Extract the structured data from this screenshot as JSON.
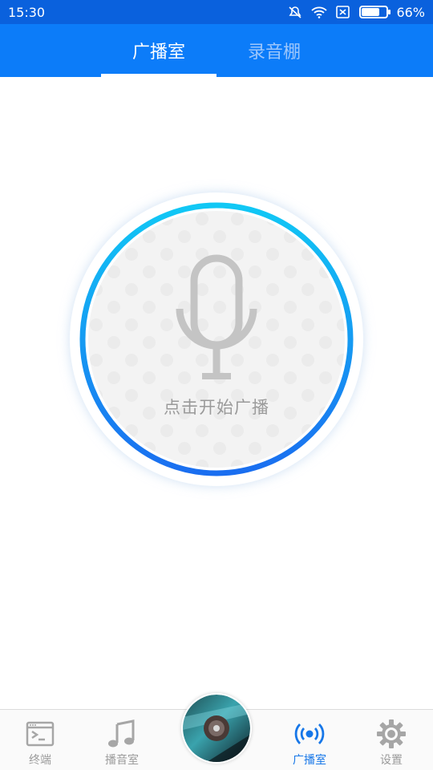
{
  "status_bar": {
    "time": "15:30",
    "battery": "66%",
    "battery_level": 0.66,
    "icons": [
      "mute-icon",
      "wifi-icon",
      "sim-icon",
      "battery-icon"
    ]
  },
  "tabs": [
    {
      "label": "广播室",
      "active": true
    },
    {
      "label": "录音棚",
      "active": false
    }
  ],
  "mic": {
    "label": "点击开始广播",
    "icon": "microphone-icon",
    "ring_gradient": [
      "#11c8f5",
      "#1a6ef0"
    ]
  },
  "bottom_nav": [
    {
      "label": "终端",
      "icon": "terminal-icon",
      "active": false
    },
    {
      "label": "播音室",
      "icon": "music-note-icon",
      "active": false
    },
    {
      "label": "",
      "icon": "album-disc-icon",
      "active": false
    },
    {
      "label": "广播室",
      "icon": "broadcast-icon",
      "active": true
    },
    {
      "label": "设置",
      "icon": "gear-icon",
      "active": false
    }
  ],
  "colors": {
    "status_bar": "#0a61dd",
    "tab_bar": "#0c7cf9",
    "accent": "#1777e8",
    "inactive": "#9b9b9b"
  }
}
